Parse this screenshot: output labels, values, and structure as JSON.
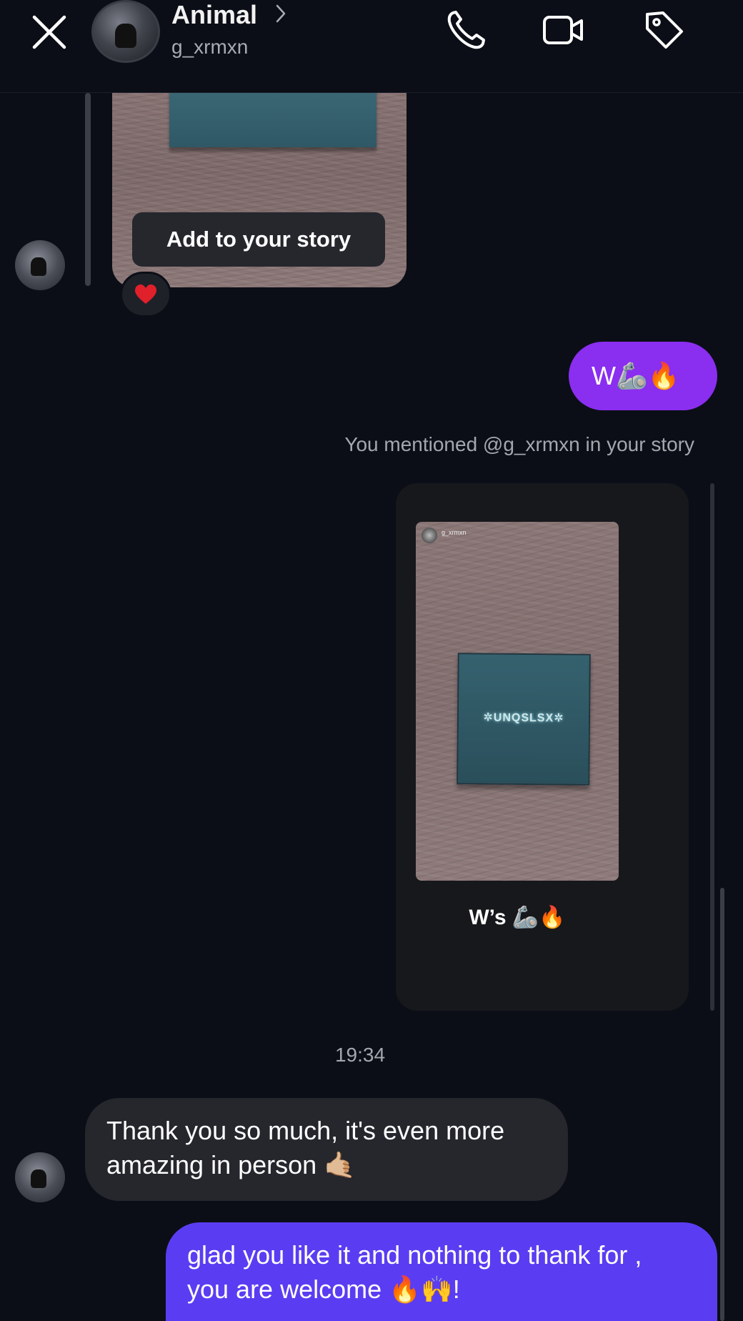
{
  "header": {
    "contact_name": "Animal",
    "username": "g_xrmxn",
    "icons": [
      "close-icon",
      "chevron-right-icon",
      "phone-icon",
      "video-icon",
      "tag-icon"
    ]
  },
  "story_reply": {
    "add_to_story_label": "Add to your story",
    "reaction": "❤️"
  },
  "messages": [
    {
      "from": "me",
      "text": "W🦾🔥"
    },
    {
      "from": "system",
      "text": "You mentioned @g_xrmxn in your story"
    },
    {
      "from": "me",
      "type": "story",
      "story_user": "g_xrmxn",
      "card_text": "✲UNQSLSX✲",
      "caption": "W’s 🦾🔥"
    },
    {
      "from": "system",
      "text": "19:34"
    },
    {
      "from": "them",
      "text_line1": "Thank you so much, it's even more",
      "text_line2": "amazing in person 🤙🏼"
    },
    {
      "from": "me",
      "text_line1": "glad you like it and nothing to thank for ,",
      "text_line2": "you are welcome 🔥🙌!"
    }
  ],
  "colors": {
    "background": "#0b0e16",
    "purple_bubble": "#8a2ef0",
    "blue_bubble": "#5a3df2",
    "gray_bubble": "#25272d",
    "heart": "#e0202a"
  }
}
